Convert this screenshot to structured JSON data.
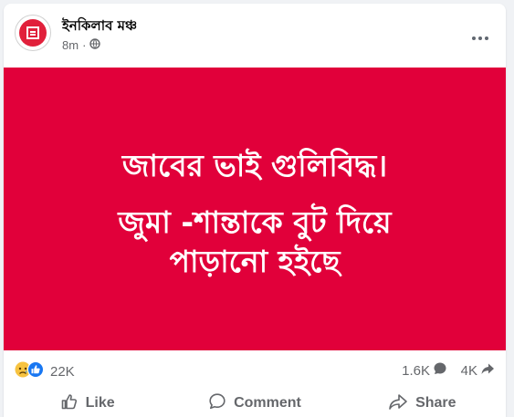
{
  "post": {
    "page_name": "ইনকিলাব মঞ্চ",
    "time": "8m",
    "separator": "·",
    "privacy_icon": "globe-icon",
    "more_icon": "more-icon"
  },
  "banner": {
    "background_color": "#e1003a",
    "lines": [
      "জাবের ভাই গুলিবিদ্ধ।",
      "জুমা -শান্তাকে বুট দিয়ে",
      "পাড়ানো হইছে"
    ]
  },
  "stats": {
    "reactions_count": "22K",
    "reaction_icons": [
      "sad-reaction-icon",
      "like-reaction-icon"
    ],
    "comments_count": "1.6K",
    "shares_count": "4K"
  },
  "actions": {
    "like_label": "Like",
    "comment_label": "Comment",
    "share_label": "Share"
  }
}
